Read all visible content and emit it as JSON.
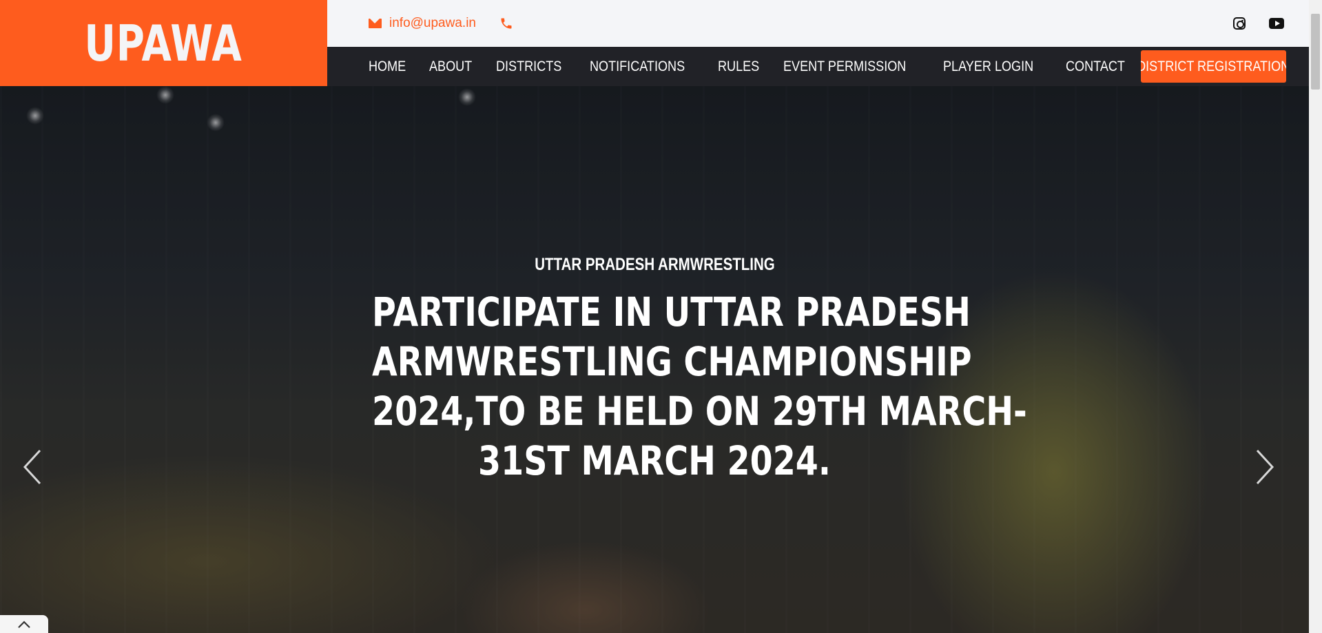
{
  "brand": {
    "logo_text": "UPAWA",
    "accent_color": "#fe5c1e"
  },
  "topbar": {
    "email": "info@upawa.in",
    "email_icon": "envelope-icon",
    "phone_icon": "phone-icon",
    "social": [
      "instagram-icon",
      "youtube-icon"
    ]
  },
  "nav": {
    "items": [
      "HOME",
      "ABOUT",
      "DISTRICTS",
      "NOTIFICATIONS",
      "RULES",
      "EVENT PERMISSION",
      "PLAYER LOGIN",
      "CONTACT"
    ],
    "cta_label": "DISTRICT REGISTRATION"
  },
  "hero": {
    "subtitle": "UTTAR PRADESH ARMWRESTLING",
    "title_lines": [
      "PARTICIPATE IN UTTAR PRADESH",
      "ARMWRESTLING CHAMPIONSHIP",
      "2024,TO BE HELD ON 29TH MARCH-",
      "31ST MARCH 2024."
    ],
    "prev_icon": "chevron-left-icon",
    "next_icon": "chevron-right-icon"
  },
  "back_to_top_icon": "chevron-up-icon"
}
